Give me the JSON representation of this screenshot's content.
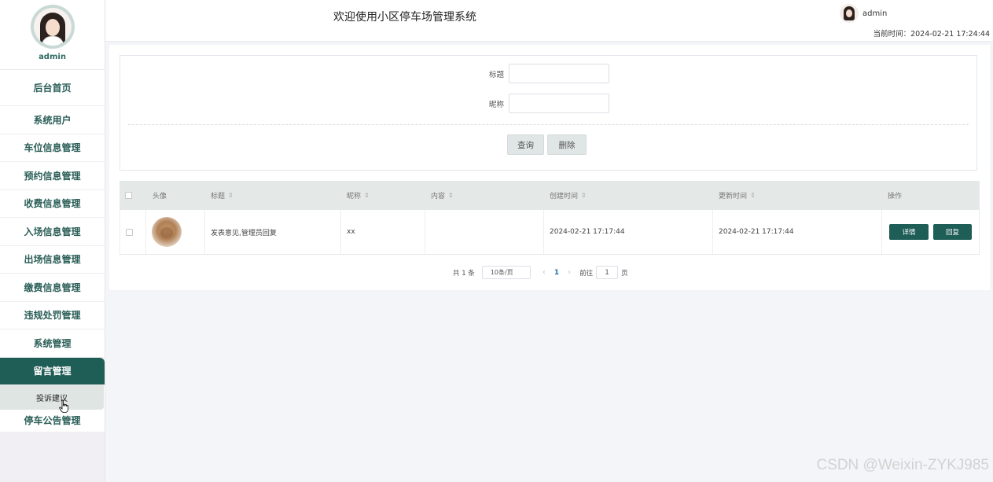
{
  "sidebar": {
    "username": "admin",
    "home": "后台首页",
    "items": [
      "系统用户",
      "车位信息管理",
      "预约信息管理",
      "收费信息管理",
      "入场信息管理",
      "出场信息管理",
      "缴费信息管理",
      "违规处罚管理",
      "系统管理"
    ],
    "active": "留言管理",
    "submenu": "投诉建议",
    "after": "停车公告管理"
  },
  "header": {
    "title": "欢迎使用小区停车场管理系统",
    "username": "admin",
    "time": "当前时间：2024-02-21 17:24:44"
  },
  "search": {
    "title_label": "标题",
    "nickname_label": "昵称",
    "title_value": "",
    "nickname_value": "",
    "query_button": "查询",
    "delete_button": "删除"
  },
  "table": {
    "headers": {
      "avatar": "头像",
      "title": "标题",
      "nickname": "昵称",
      "content": "内容",
      "created": "创建时间",
      "updated": "更新时间",
      "actions": "操作"
    },
    "rows": [
      {
        "title": "发表意见,管理员回复",
        "nickname": "xx",
        "content": "",
        "created": "2024-02-21 17:17:44",
        "updated": "2024-02-21 17:17:44",
        "detail_button": "详情",
        "reply_button": "回复"
      }
    ]
  },
  "pagination": {
    "total": "共 1 条",
    "page_size": "10条/页",
    "current_page": "1",
    "goto_prefix": "前往",
    "goto_value": "1",
    "goto_suffix": "页"
  },
  "watermark": "CSDN @Weixin-ZYKJ985",
  "colors": {
    "primary": "#1f5d57",
    "menu_text": "#2a5e57",
    "table_header": "#e4e9e8",
    "background": "#f4f5f9"
  }
}
